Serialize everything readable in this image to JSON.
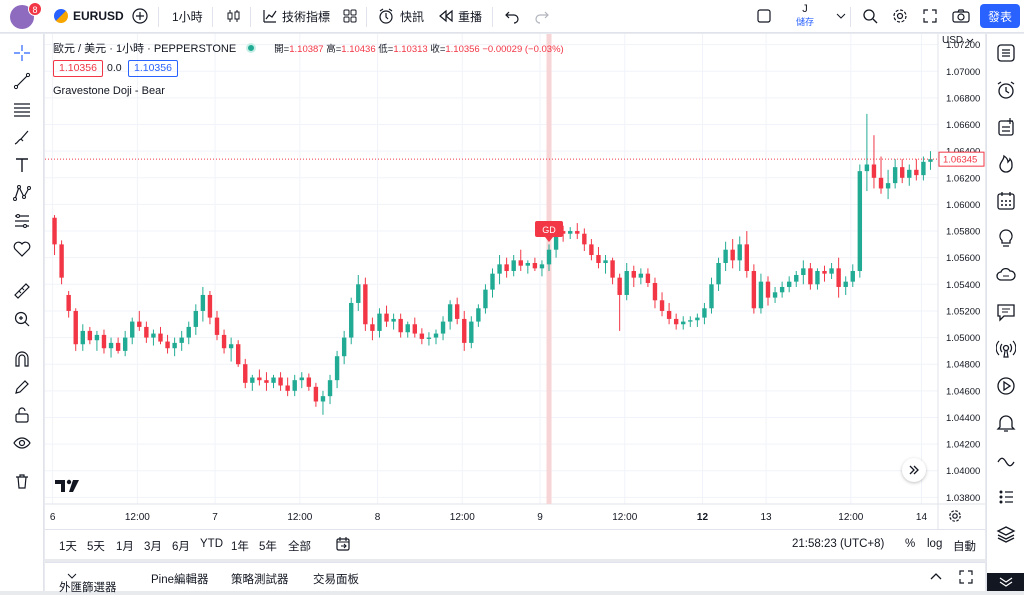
{
  "header": {
    "notification_count": "8",
    "symbol": "EURUSD",
    "interval": "1小時",
    "indicators_label": "技術指標",
    "alert_label": "快訊",
    "replay_label": "重播",
    "layout_initial": "J",
    "layout_label": "儲存",
    "publish_label": "發表"
  },
  "legend": {
    "title": "歐元 / 美元 · 1小時 · PEPPERSTONE",
    "open_label": "開=",
    "open": "1.10387",
    "high_label": "高=",
    "high": "1.10436",
    "low_label": "低=",
    "low": "1.10313",
    "close_label": "收=",
    "close": "1.10356",
    "change": "−0.00029 (−0.03%)",
    "sell_price": "1.10356",
    "spread": "0.0",
    "buy_price": "1.10356",
    "indicator_name": "Gravestone Doji - Bear"
  },
  "chart_data": {
    "type": "candlestick",
    "currency": "USD",
    "y_ticks": [
      "1.07200",
      "1.07000",
      "1.06800",
      "1.06600",
      "1.06400",
      "1.06200",
      "1.06000",
      "1.05800",
      "1.05600",
      "1.05400",
      "1.05200",
      "1.05000",
      "1.04800",
      "1.04600",
      "1.04400",
      "1.04200",
      "1.04000",
      "1.03800"
    ],
    "y_range": [
      1.0375,
      1.0728
    ],
    "x_ticks": [
      "6",
      "12:00",
      "7",
      "12:00",
      "8",
      "12:00",
      "9",
      "12:00",
      "12",
      "13",
      "12:00",
      "14"
    ],
    "last_price_label": "1.06345",
    "marker_label": "GD",
    "candles": [
      [
        1.059,
        1.0592,
        1.0562,
        1.057
      ],
      [
        1.057,
        1.0573,
        1.054,
        1.0545
      ],
      [
        1.0532,
        1.0535,
        1.0515,
        1.052
      ],
      [
        1.052,
        1.0522,
        1.049,
        1.0495
      ],
      [
        1.0495,
        1.051,
        1.049,
        1.0505
      ],
      [
        1.0505,
        1.0508,
        1.0495,
        1.0498
      ],
      [
        1.0498,
        1.0505,
        1.049,
        1.0502
      ],
      [
        1.0502,
        1.0506,
        1.0488,
        1.0492
      ],
      [
        1.0492,
        1.05,
        1.0485,
        1.0496
      ],
      [
        1.0496,
        1.05,
        1.0488,
        1.049
      ],
      [
        1.049,
        1.0505,
        1.0486,
        1.05
      ],
      [
        1.05,
        1.0515,
        1.0495,
        1.0512
      ],
      [
        1.0512,
        1.052,
        1.0505,
        1.0508
      ],
      [
        1.0508,
        1.0512,
        1.0496,
        1.05
      ],
      [
        1.05,
        1.0506,
        1.0494,
        1.0503
      ],
      [
        1.0503,
        1.0508,
        1.0495,
        1.0497
      ],
      [
        1.0497,
        1.0502,
        1.0488,
        1.0492
      ],
      [
        1.0492,
        1.05,
        1.0486,
        1.0496
      ],
      [
        1.0496,
        1.0505,
        1.049,
        1.05
      ],
      [
        1.05,
        1.0512,
        1.0495,
        1.0508
      ],
      [
        1.0508,
        1.0525,
        1.0502,
        1.052
      ],
      [
        1.052,
        1.0538,
        1.0512,
        1.0532
      ],
      [
        1.0532,
        1.0535,
        1.051,
        1.0515
      ],
      [
        1.0515,
        1.052,
        1.0498,
        1.0502
      ],
      [
        1.0502,
        1.0506,
        1.0488,
        1.0492
      ],
      [
        1.0492,
        1.05,
        1.0482,
        1.0495
      ],
      [
        1.0495,
        1.0498,
        1.0478,
        1.048
      ],
      [
        1.048,
        1.0484,
        1.0462,
        1.0466
      ],
      [
        1.0466,
        1.0472,
        1.046,
        1.047
      ],
      [
        1.047,
        1.0476,
        1.0464,
        1.0468
      ],
      [
        1.0468,
        1.0474,
        1.046,
        1.0466
      ],
      [
        1.0466,
        1.0472,
        1.0462,
        1.047
      ],
      [
        1.047,
        1.0474,
        1.046,
        1.0464
      ],
      [
        1.0464,
        1.047,
        1.0456,
        1.046
      ],
      [
        1.046,
        1.0472,
        1.0456,
        1.0468
      ],
      [
        1.0468,
        1.0474,
        1.0462,
        1.047
      ],
      [
        1.047,
        1.0473,
        1.046,
        1.0463
      ],
      [
        1.0463,
        1.0466,
        1.0448,
        1.0452
      ],
      [
        1.0452,
        1.046,
        1.0442,
        1.0456
      ],
      [
        1.0456,
        1.0472,
        1.045,
        1.0468
      ],
      [
        1.0468,
        1.049,
        1.0462,
        1.0486
      ],
      [
        1.0486,
        1.0505,
        1.048,
        1.05
      ],
      [
        1.05,
        1.053,
        1.0495,
        1.0526
      ],
      [
        1.0526,
        1.0547,
        1.052,
        1.054
      ],
      [
        1.054,
        1.0545,
        1.0505,
        1.051
      ],
      [
        1.051,
        1.0515,
        1.0498,
        1.0505
      ],
      [
        1.0505,
        1.0522,
        1.05,
        1.0518
      ],
      [
        1.0518,
        1.0524,
        1.0508,
        1.0512
      ],
      [
        1.0512,
        1.0518,
        1.0506,
        1.0514
      ],
      [
        1.0514,
        1.0518,
        1.05,
        1.0504
      ],
      [
        1.0504,
        1.0512,
        1.05,
        1.051
      ],
      [
        1.051,
        1.0515,
        1.05,
        1.0503
      ],
      [
        1.0503,
        1.0507,
        1.0495,
        1.0499
      ],
      [
        1.0499,
        1.0504,
        1.0494,
        1.05
      ],
      [
        1.05,
        1.0506,
        1.0495,
        1.0503
      ],
      [
        1.0503,
        1.0516,
        1.0498,
        1.0512
      ],
      [
        1.0512,
        1.0528,
        1.0506,
        1.0525
      ],
      [
        1.0525,
        1.053,
        1.051,
        1.0514
      ],
      [
        1.0514,
        1.052,
        1.049,
        1.0496
      ],
      [
        1.0496,
        1.0516,
        1.0492,
        1.0512
      ],
      [
        1.0512,
        1.0525,
        1.0508,
        1.0522
      ],
      [
        1.0522,
        1.054,
        1.0518,
        1.0536
      ],
      [
        1.0536,
        1.0552,
        1.053,
        1.0548
      ],
      [
        1.0548,
        1.0562,
        1.054,
        1.0555
      ],
      [
        1.0555,
        1.056,
        1.0545,
        1.055
      ],
      [
        1.055,
        1.0562,
        1.0546,
        1.0558
      ],
      [
        1.0558,
        1.0566,
        1.055,
        1.0554
      ],
      [
        1.0554,
        1.0558,
        1.0548,
        1.0556
      ],
      [
        1.0556,
        1.056,
        1.055,
        1.0552
      ],
      [
        1.0552,
        1.0558,
        1.0546,
        1.0555
      ],
      [
        1.0555,
        1.057,
        1.055,
        1.0566
      ],
      [
        1.0566,
        1.0584,
        1.056,
        1.058
      ],
      [
        1.058,
        1.0584,
        1.0572,
        1.0578
      ],
      [
        1.0578,
        1.0583,
        1.0574,
        1.058
      ],
      [
        1.058,
        1.0586,
        1.0574,
        1.0578
      ],
      [
        1.0578,
        1.0582,
        1.0565,
        1.057
      ],
      [
        1.057,
        1.0574,
        1.0558,
        1.0562
      ],
      [
        1.0562,
        1.0568,
        1.0552,
        1.0556
      ],
      [
        1.0556,
        1.0562,
        1.0548,
        1.0558
      ],
      [
        1.0558,
        1.056,
        1.054,
        1.0545
      ],
      [
        1.0545,
        1.0548,
        1.0505,
        1.0532
      ],
      [
        1.0532,
        1.0556,
        1.0528,
        1.055
      ],
      [
        1.055,
        1.0554,
        1.0538,
        1.0545
      ],
      [
        1.0545,
        1.0552,
        1.054,
        1.0548
      ],
      [
        1.0548,
        1.0552,
        1.0538,
        1.0541
      ],
      [
        1.0541,
        1.0545,
        1.0522,
        1.0528
      ],
      [
        1.0528,
        1.0534,
        1.0516,
        1.052
      ],
      [
        1.052,
        1.0526,
        1.051,
        1.0514
      ],
      [
        1.0514,
        1.0518,
        1.0506,
        1.051
      ],
      [
        1.051,
        1.0516,
        1.0506,
        1.0512
      ],
      [
        1.0512,
        1.0516,
        1.0508,
        1.0513
      ],
      [
        1.0513,
        1.0518,
        1.0508,
        1.0515
      ],
      [
        1.0515,
        1.0526,
        1.051,
        1.0522
      ],
      [
        1.0522,
        1.0545,
        1.0518,
        1.054
      ],
      [
        1.054,
        1.056,
        1.0535,
        1.0556
      ],
      [
        1.0556,
        1.0572,
        1.055,
        1.0566
      ],
      [
        1.0566,
        1.0574,
        1.0552,
        1.0558
      ],
      [
        1.0558,
        1.0576,
        1.055,
        1.057
      ],
      [
        1.057,
        1.058,
        1.0545,
        1.055
      ],
      [
        1.055,
        1.0555,
        1.0518,
        1.0522
      ],
      [
        1.0522,
        1.0548,
        1.0518,
        1.0542
      ],
      [
        1.0542,
        1.0546,
        1.0524,
        1.053
      ],
      [
        1.053,
        1.0538,
        1.0526,
        1.0534
      ],
      [
        1.0534,
        1.0542,
        1.053,
        1.0538
      ],
      [
        1.0538,
        1.0546,
        1.0534,
        1.0542
      ],
      [
        1.0542,
        1.055,
        1.0538,
        1.0547
      ],
      [
        1.0547,
        1.0558,
        1.054,
        1.0552
      ],
      [
        1.0552,
        1.0556,
        1.0536,
        1.054
      ],
      [
        1.054,
        1.0552,
        1.0536,
        1.055
      ],
      [
        1.055,
        1.0554,
        1.0542,
        1.0548
      ],
      [
        1.0548,
        1.0556,
        1.0544,
        1.0552
      ],
      [
        1.0552,
        1.056,
        1.053,
        1.0538
      ],
      [
        1.0538,
        1.0546,
        1.0532,
        1.0542
      ],
      [
        1.0542,
        1.0555,
        1.0538,
        1.055
      ],
      [
        1.055,
        1.063,
        1.0545,
        1.0625
      ],
      [
        1.0625,
        1.0668,
        1.061,
        1.063
      ],
      [
        1.063,
        1.0652,
        1.0612,
        1.062
      ],
      [
        1.062,
        1.0636,
        1.0608,
        1.0612
      ],
      [
        1.0612,
        1.0626,
        1.0604,
        1.0616
      ],
      [
        1.0616,
        1.0634,
        1.0612,
        1.0628
      ],
      [
        1.0628,
        1.0634,
        1.0616,
        1.062
      ],
      [
        1.062,
        1.063,
        1.0614,
        1.0626
      ],
      [
        1.0626,
        1.0634,
        1.0618,
        1.0622
      ],
      [
        1.0622,
        1.0636,
        1.0618,
        1.0632
      ],
      [
        1.0632,
        1.064,
        1.0626,
        1.0634
      ]
    ]
  },
  "time_ranges": [
    "1天",
    "5天",
    "1月",
    "3月",
    "6月",
    "YTD",
    "1年",
    "5年",
    "全部"
  ],
  "clock": "21:58:23 (UTC+8)",
  "scale_opts": [
    "%",
    "log",
    "自動"
  ],
  "panels": [
    "外匯篩選器",
    "Pine編輯器",
    "策略測試器",
    "交易面板"
  ]
}
